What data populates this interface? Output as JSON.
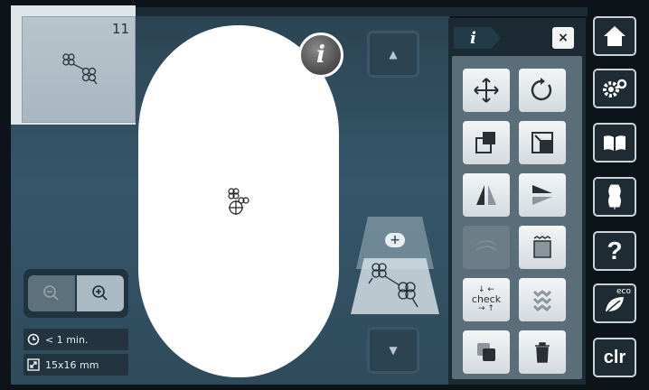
{
  "thumbnail": {
    "number": "11"
  },
  "info_button": {
    "label": "i"
  },
  "status": {
    "time": "< 1 min.",
    "size": "15x16 mm"
  },
  "tool_panel": {
    "info_tab": "i",
    "close": "×",
    "check_label": "check"
  },
  "sidebar": {
    "clr_label": "clr",
    "help_label": "?",
    "eco_label": "eco"
  },
  "colors": {
    "background": "#0c141a",
    "canvas": "#36566a",
    "hoop": "#ffffff",
    "panel": "#1b2a33",
    "tool_grid": "#5a6e79"
  },
  "icons": [
    "home-icon",
    "settings-icon",
    "book-icon",
    "dress-form-icon",
    "help-icon",
    "eco-leaf-icon",
    "clear-icon",
    "move-icon",
    "rotate-icon",
    "resize-icon",
    "scale-proportional-icon",
    "mirror-vertical-icon",
    "mirror-horizontal-icon",
    "stitch-type-icon",
    "fill-pattern-icon",
    "check-icon",
    "stack-icon",
    "duplicate-icon",
    "trash-icon",
    "zoom-out-icon",
    "zoom-in-icon",
    "clock-icon",
    "resize-arrow-icon"
  ]
}
